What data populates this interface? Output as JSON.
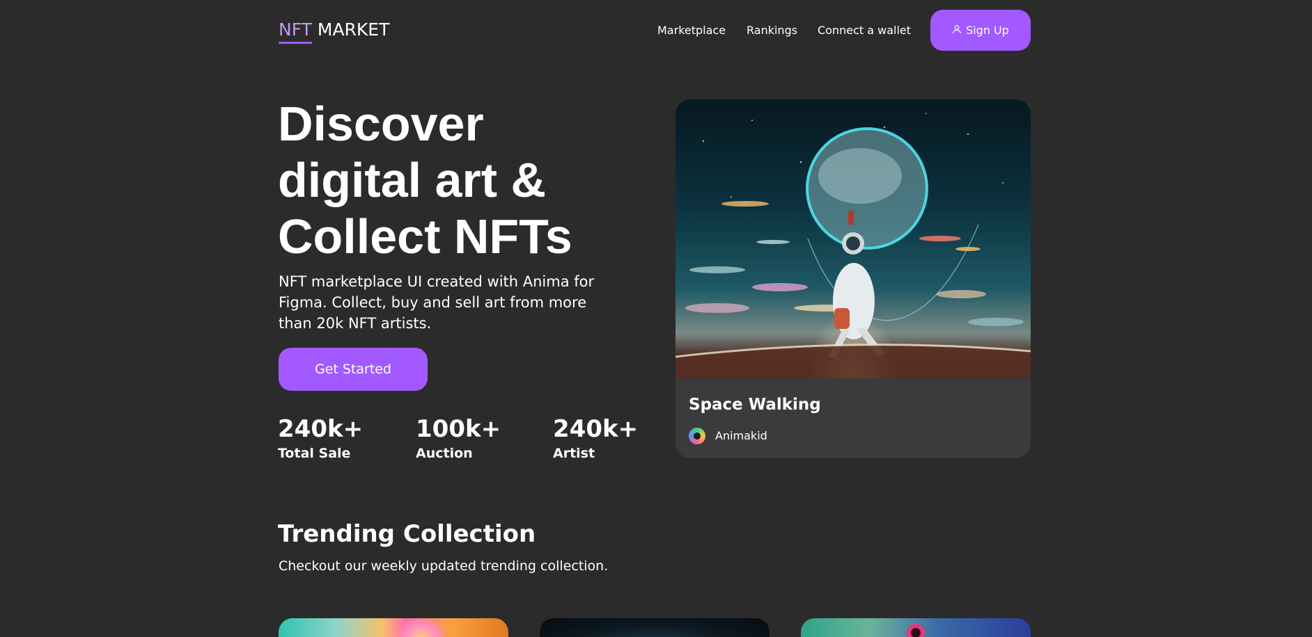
{
  "header": {
    "logo_nft": "NFT",
    "logo_market": " MARKET",
    "nav": [
      "Marketplace",
      "Rankings",
      "Connect a wallet"
    ],
    "signup_label": "Sign Up"
  },
  "hero": {
    "title_line1": "Discover",
    "title_line2": "digital art &",
    "title_line3": "Collect NFTs",
    "description": "NFT marketplace UI created with Anima for Figma. Collect, buy and sell art from more than 20k NFT artists.",
    "cta_label": "Get Started",
    "stats": [
      {
        "value": "240k+",
        "label": "Total Sale"
      },
      {
        "value": "100k+",
        "label": "Auction"
      },
      {
        "value": "240k+",
        "label": "Artist"
      }
    ]
  },
  "featured": {
    "name": "Space Walking",
    "artist": "Animakid"
  },
  "trending": {
    "title": "Trending Collection",
    "subtitle": "Checkout our weekly updated trending collection."
  },
  "colors": {
    "background": "#2b2b2b",
    "accent": "#a259ff",
    "card": "#3b3b3b"
  }
}
